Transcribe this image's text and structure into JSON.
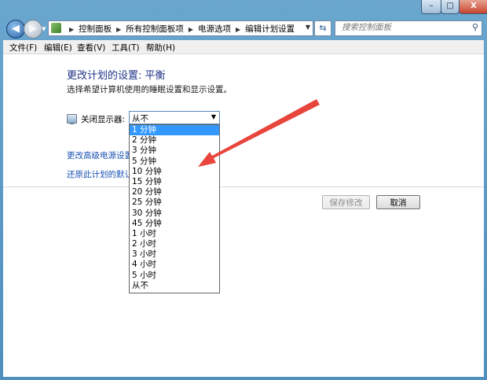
{
  "window": {
    "minimize": "–",
    "maximize": "□",
    "close": "X"
  },
  "nav": {
    "back": "◀",
    "forward": "▶",
    "history_dropdown": "▼",
    "refresh": "⇆",
    "breadcrumbs": [
      "控制面板",
      "所有控制面板项",
      "电源选项",
      "编辑计划设置"
    ],
    "search_placeholder": "搜索控制面板"
  },
  "menu": {
    "file": "文件(F)",
    "edit": "编辑(E)",
    "view": "查看(V)",
    "tools": "工具(T)",
    "help": "帮助(H)"
  },
  "content": {
    "title": "更改计划的设置: 平衡",
    "subtitle": "选择希望计算机使用的睡眠设置和显示设置。",
    "display_off_label": "关闭显示器:",
    "display_off_value": "从不",
    "advanced_link": "更改高级电源设置(C)",
    "restore_link": "还原此计划的默认设置(R)",
    "save_button": "保存修改",
    "cancel_button": "取消"
  },
  "dropdown_options": [
    "1 分钟",
    "2 分钟",
    "3 分钟",
    "5 分钟",
    "10 分钟",
    "15 分钟",
    "20 分钟",
    "25 分钟",
    "30 分钟",
    "45 分钟",
    "1 小时",
    "2 小时",
    "3 小时",
    "4 小时",
    "5 小时",
    "从不"
  ],
  "highlighted_option": "1 分钟",
  "colors": {
    "title": "#1e3287",
    "link": "#1a52b5",
    "highlight": "#3399ff",
    "annotation_arrow": "#e8453c",
    "window_frame": "#5b9bc8"
  },
  "icons": {
    "control_panel": "control-panel-icon",
    "monitor": "monitor-icon",
    "search": "search-icon"
  }
}
